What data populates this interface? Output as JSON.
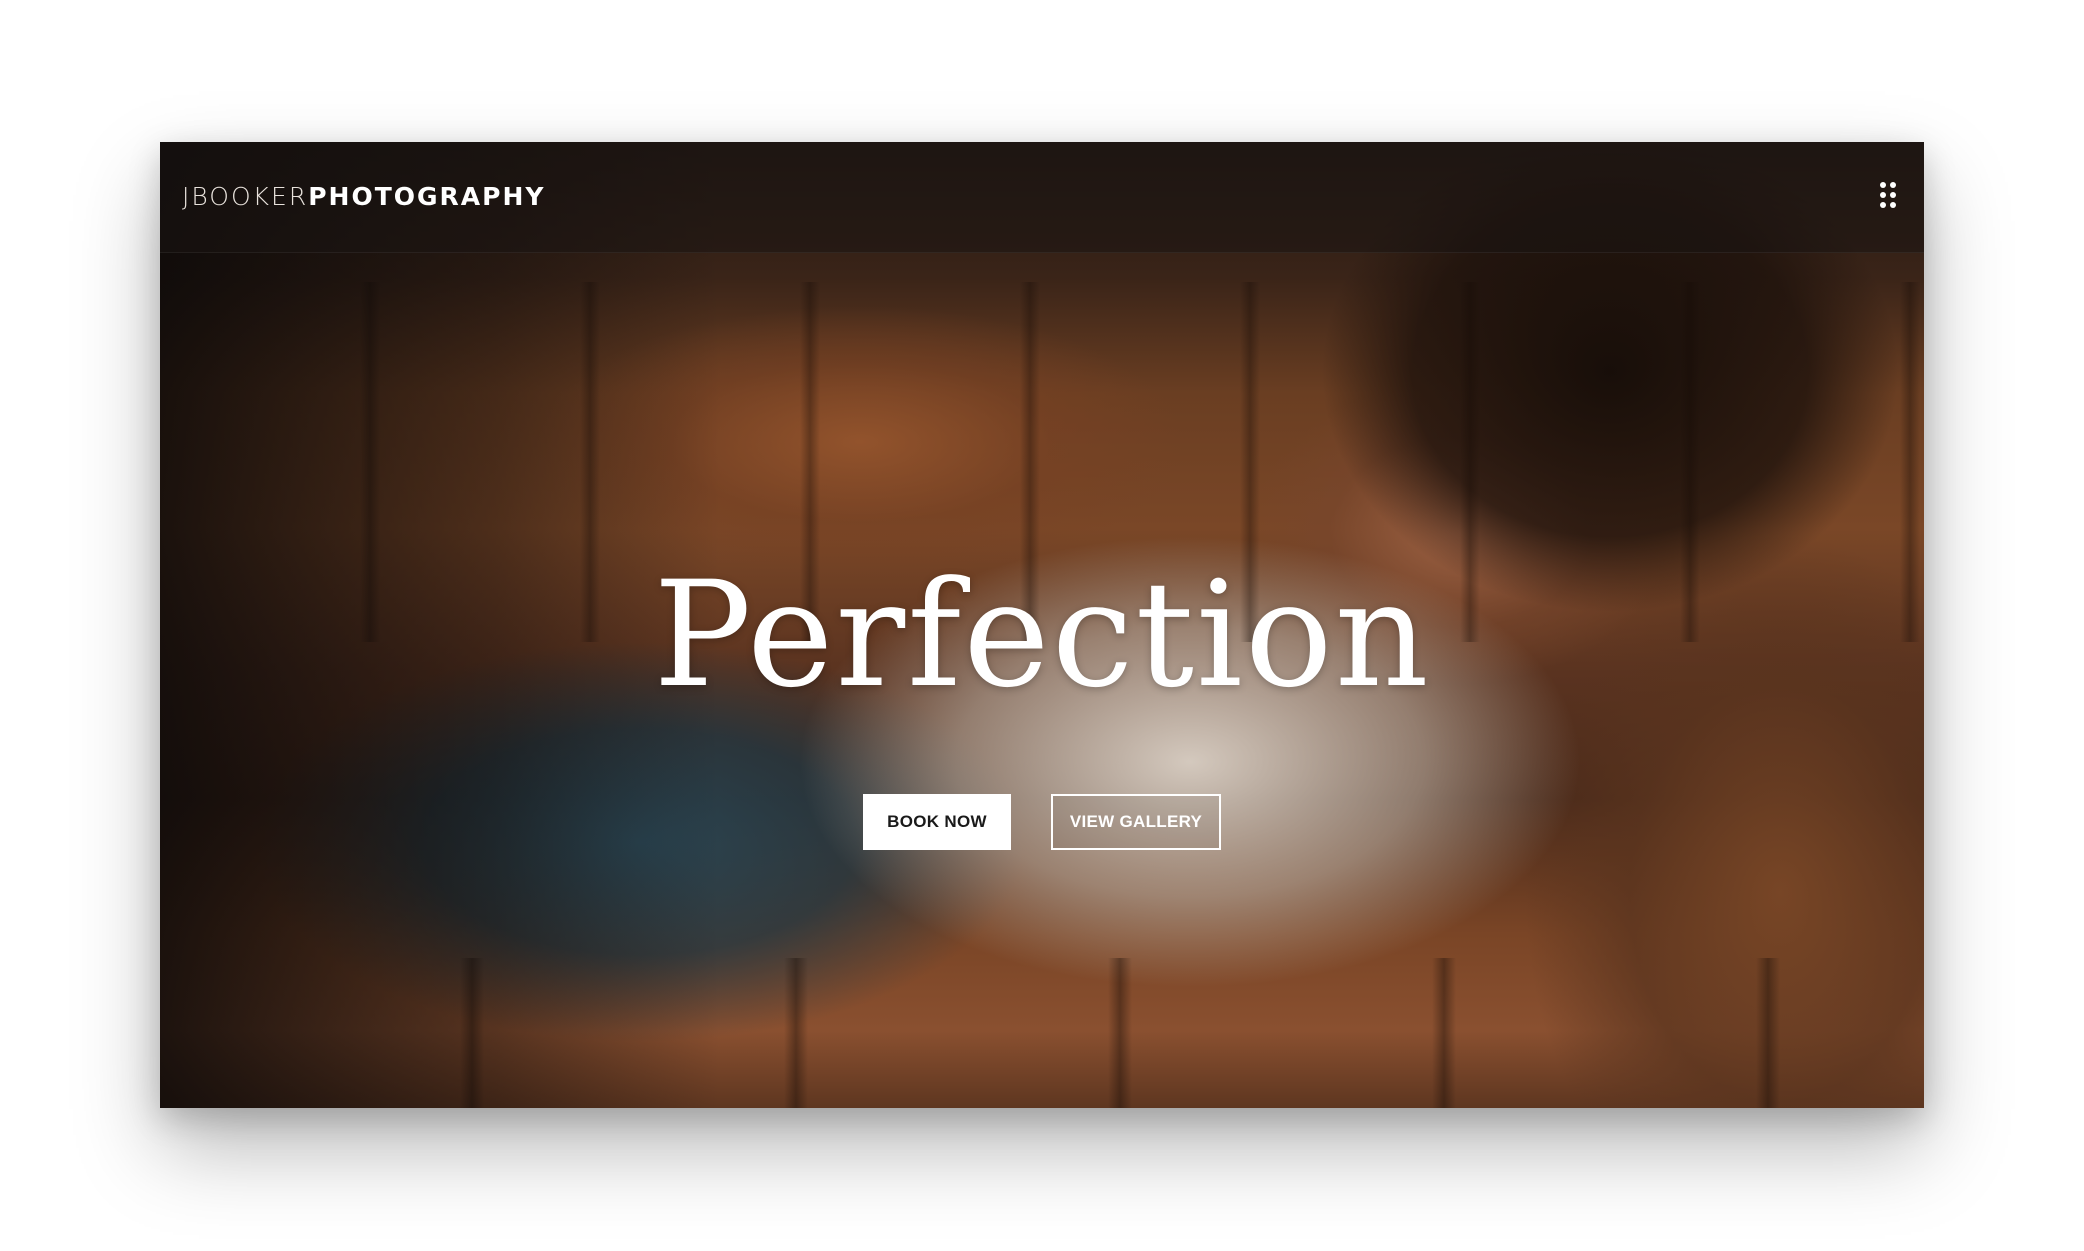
{
  "header": {
    "logo_light": "JBOOKER",
    "logo_bold": "PHOTOGRAPHY",
    "menu_icon": "grid-dots-icon"
  },
  "hero": {
    "headline": "Perfection",
    "primary_button": "BOOK NOW",
    "secondary_button": "VIEW GALLERY"
  },
  "colors": {
    "text": "#ffffff",
    "primary_button_bg": "#ffffff",
    "primary_button_text": "#1a1a1a"
  }
}
